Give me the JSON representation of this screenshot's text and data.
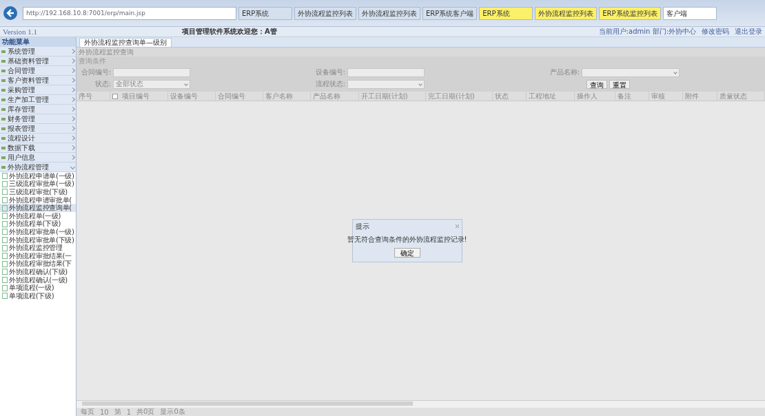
{
  "browser": {
    "address": "http://192.168.10.8:7001/erp/main.jsp",
    "tabs": [
      {
        "label": "ERP系统",
        "selected": false,
        "highlighted": false
      },
      {
        "label": "外协流程监控列表",
        "selected": false,
        "highlighted": false
      },
      {
        "label": "外协流程监控列表",
        "selected": false,
        "highlighted": false
      },
      {
        "label": "ERP系统客户端",
        "selected": false,
        "highlighted": false
      },
      {
        "label": "ERP系统",
        "selected": false,
        "highlighted": true
      },
      {
        "label": "外协流程监控列表",
        "selected": false,
        "highlighted": true
      },
      {
        "label": "ERP系统监控列表",
        "selected": false,
        "highlighted": true
      },
      {
        "label": "客户端",
        "selected": true,
        "highlighted": false
      }
    ]
  },
  "app": {
    "version": "Version 1.1",
    "title": "项目管理软件系统欢迎您：A管",
    "links": [
      "当前用户:admin 部门:外协中心",
      "修改密码",
      "退出登录"
    ]
  },
  "sidebar": {
    "title": "功能菜单",
    "items": [
      {
        "label": "系统管理",
        "expanded": false
      },
      {
        "label": "基础资料管理",
        "expanded": false
      },
      {
        "label": "合同管理",
        "expanded": false
      },
      {
        "label": "客户资料管理",
        "expanded": false
      },
      {
        "label": "采购管理",
        "expanded": false
      },
      {
        "label": "生产加工管理",
        "expanded": false
      },
      {
        "label": "库存管理",
        "expanded": false
      },
      {
        "label": "财务管理",
        "expanded": false
      },
      {
        "label": "报表管理",
        "expanded": false
      },
      {
        "label": "流程设计",
        "expanded": false
      },
      {
        "label": "数据下载",
        "expanded": false
      },
      {
        "label": "用户信息",
        "expanded": false
      },
      {
        "label": "外协流程管理",
        "expanded": true,
        "children": [
          {
            "label": "外协流程申请单(一级)",
            "selected": false
          },
          {
            "label": "三级流程审批单(一级)",
            "selected": false
          },
          {
            "label": "三级流程审批(下级)",
            "selected": false
          },
          {
            "label": "外协流程申请审批单(",
            "selected": false
          },
          {
            "label": "外协流程监控查询单(",
            "selected": true
          },
          {
            "label": "外协流程单(一级)",
            "selected": false
          },
          {
            "label": "外协流程单(下级)",
            "selected": false
          },
          {
            "label": "外协流程审批单(一级)",
            "selected": false
          },
          {
            "label": "外协流程审批单(下级)",
            "selected": false
          },
          {
            "label": "外协流程监控管理",
            "selected": false
          },
          {
            "label": "外协流程审批结果(一",
            "selected": false
          },
          {
            "label": "外协流程审批结果(下",
            "selected": false
          },
          {
            "label": "外协流程确认(下级)",
            "selected": false
          },
          {
            "label": "外协流程确认(一级)",
            "selected": false
          },
          {
            "label": "单项流程(一级)",
            "selected": false
          },
          {
            "label": "单项流程(下级)",
            "selected": false
          }
        ]
      }
    ]
  },
  "tab": {
    "label": "外协流程监控查询单—级别"
  },
  "panel": {
    "title": "外协流程监控查询",
    "section": "查询条件",
    "fields": [
      {
        "label": "合同编号:",
        "kind": "text"
      },
      {
        "label": "设备编号:",
        "kind": "text"
      },
      {
        "label": "产品名称:",
        "kind": "select"
      },
      {
        "label": "状态:",
        "value": "全部状态",
        "kind": "select"
      },
      {
        "label": "流程状态:",
        "kind": "select"
      }
    ],
    "buttons": [
      "查询",
      "重置"
    ]
  },
  "table": {
    "columns": [
      {
        "kind": "text",
        "label": "序号"
      },
      {
        "kind": "checkbox",
        "checked": false
      },
      {
        "kind": "text",
        "label": "项目编号"
      },
      {
        "kind": "text",
        "label": "设备编号"
      },
      {
        "kind": "text",
        "label": "合同编号"
      },
      {
        "kind": "text",
        "label": "客户名称"
      },
      {
        "kind": "text",
        "label": "产品名称"
      },
      {
        "kind": "text",
        "label": "开工日期(计划)"
      },
      {
        "kind": "text",
        "label": "完工日期(计划)"
      },
      {
        "kind": "text",
        "label": "状态"
      },
      {
        "kind": "text",
        "label": "工程地址"
      },
      {
        "kind": "text",
        "label": "操作人"
      },
      {
        "kind": "text",
        "label": "备注"
      },
      {
        "kind": "text",
        "label": "审核"
      },
      {
        "kind": "text",
        "label": "附件"
      },
      {
        "kind": "text",
        "label": "质量状态"
      }
    ]
  },
  "pager": {
    "items": [
      "每页",
      "10",
      "第",
      "1",
      "共0页",
      "显示0条"
    ]
  },
  "dialog": {
    "title": "提示",
    "message": "暂无符合查询条件的外协流程监控记录!",
    "button": "确定"
  }
}
